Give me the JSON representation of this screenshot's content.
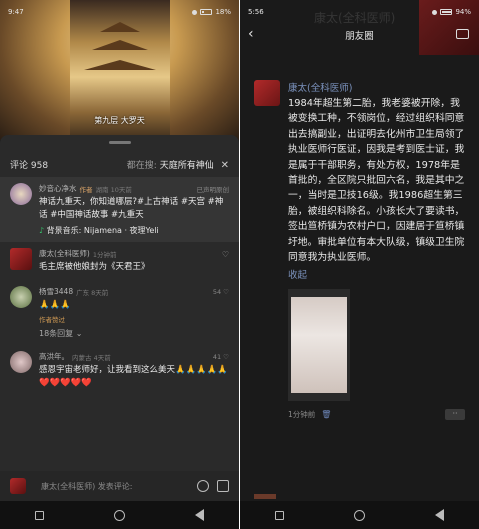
{
  "left": {
    "status": {
      "time": "9:47",
      "battery": "18%"
    },
    "video": {
      "caption": "第九层 大罗天"
    },
    "comments_header": {
      "count_label": "评论 958",
      "search_prefix": "都在搜:",
      "search_term": "天庭所有神仙"
    },
    "comments": [
      {
        "name": "妙音心净水",
        "tag": "作者",
        "sub": "湖南 10天前",
        "right": "已声明原创",
        "text": "神话九重天，你知道哪层?#上古神话 #天宫 #神话 #中国神话故事 #九重天",
        "music": "背景音乐: Nijamena · 夜理Yeli"
      },
      {
        "name": "康太(全科医师)",
        "sub": "1分钟前",
        "text": "毛主席被他娘封为《天君王》"
      },
      {
        "name": "杨雪3448",
        "sub": "广东 8天前",
        "like": "54",
        "text": "🙏🙏🙏",
        "author_liked": "作者赞过",
        "replies": "18条回复"
      },
      {
        "name": "高洪年。",
        "sub": "内蒙古 4天前",
        "like": "41",
        "text": "感恩宇宙老师好，让我看到这么美天🙏🙏🙏🙏🙏❤️❤️❤️❤️❤️"
      }
    ],
    "input": {
      "placeholder": "康太(全科医师) 发表评论:"
    }
  },
  "right": {
    "status": {
      "time": "5:56",
      "battery": "94%"
    },
    "title": "朋友圈",
    "watermark": "康太(全科医师)",
    "post": {
      "name": "康太(全科医师)",
      "text": "1984年超生第二胎，我老婆被开除，我被变换工种，不领岗位，经过组织科同意出去搞副业，出证明去化州市卫生局领了执业医师行医证，因我是考到医士证，我是属于干部职务，有处方权，1978年是首批的，全区院只批回六名，我是其中之一，当时是卫技16级。我1986超生第三胎，被组织科除名。小孩长大了要读书，签出笪桥镇为农村户口，因建居于笪桥镇圩地。审批单位有本大队级，镇级卫生院同意我为执业医师。",
      "collapse": "收起",
      "time": "1分钟前",
      "more": "··"
    }
  }
}
